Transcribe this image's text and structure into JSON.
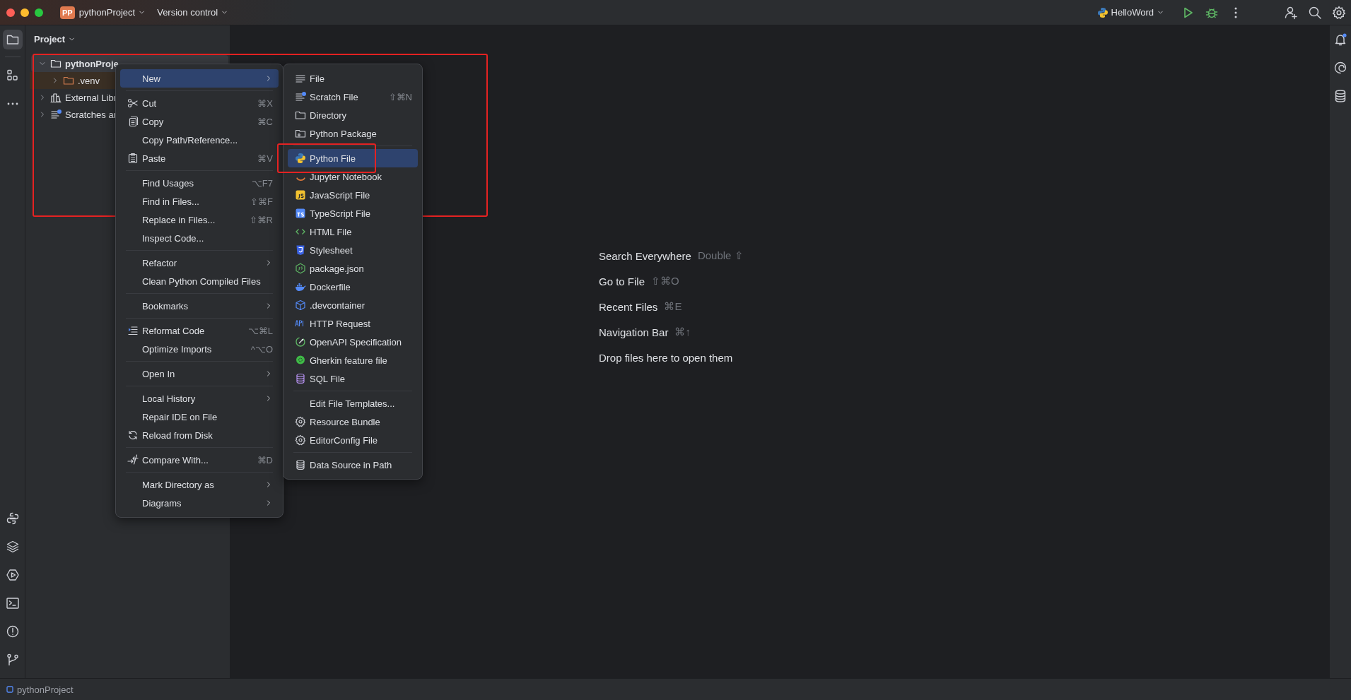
{
  "title_bar": {
    "badge": "PP",
    "project": "pythonProject",
    "vcs": "Version control",
    "run_config": "HelloWord"
  },
  "project_panel": {
    "title": "Project",
    "tree": [
      {
        "label": "pythonProje",
        "kind": "folder",
        "expanded": true,
        "selected": true,
        "children": [
          {
            "label": ".venv",
            "kind": "excluded",
            "expanded": false,
            "selected": false
          }
        ]
      },
      {
        "label": "External Libr",
        "kind": "library",
        "expanded": false,
        "selected": false
      },
      {
        "label": "Scratches ar",
        "kind": "scratches",
        "expanded": false,
        "selected": false
      }
    ]
  },
  "context_menu": {
    "groups": [
      [
        {
          "label": "New",
          "kind": "none",
          "submenu": true,
          "selected": true
        }
      ],
      [
        {
          "label": "Cut",
          "kind": "cut",
          "shortcut": "⌘X",
          "submenu": false,
          "selected": false
        },
        {
          "label": "Copy",
          "kind": "copy",
          "shortcut": "⌘C",
          "submenu": false,
          "selected": false
        },
        {
          "label": "Copy Path/Reference...",
          "kind": "none",
          "submenu": false,
          "selected": false
        },
        {
          "label": "Paste",
          "kind": "paste",
          "shortcut": "⌘V",
          "submenu": false,
          "selected": false
        }
      ],
      [
        {
          "label": "Find Usages",
          "kind": "none",
          "shortcut": "⌥F7",
          "submenu": false,
          "selected": false
        },
        {
          "label": "Find in Files...",
          "kind": "none",
          "shortcut": "⇧⌘F",
          "submenu": false,
          "selected": false
        },
        {
          "label": "Replace in Files...",
          "kind": "none",
          "shortcut": "⇧⌘R",
          "submenu": false,
          "selected": false
        },
        {
          "label": "Inspect Code...",
          "kind": "none",
          "submenu": false,
          "selected": false
        }
      ],
      [
        {
          "label": "Refactor",
          "kind": "none",
          "submenu": true,
          "selected": false
        },
        {
          "label": "Clean Python Compiled Files",
          "kind": "none",
          "submenu": false,
          "selected": false
        }
      ],
      [
        {
          "label": "Bookmarks",
          "kind": "none",
          "submenu": true,
          "selected": false
        }
      ],
      [
        {
          "label": "Reformat Code",
          "kind": "reformat",
          "shortcut": "⌥⌘L",
          "submenu": false,
          "selected": false
        },
        {
          "label": "Optimize Imports",
          "kind": "none",
          "shortcut": "^⌥O",
          "submenu": false,
          "selected": false
        }
      ],
      [
        {
          "label": "Open In",
          "kind": "none",
          "submenu": true,
          "selected": false
        }
      ],
      [
        {
          "label": "Local History",
          "kind": "none",
          "submenu": true,
          "selected": false
        },
        {
          "label": "Repair IDE on File",
          "kind": "none",
          "submenu": false,
          "selected": false
        },
        {
          "label": "Reload from Disk",
          "kind": "reload",
          "submenu": false,
          "selected": false
        }
      ],
      [
        {
          "label": "Compare With...",
          "kind": "compare",
          "shortcut": "⌘D",
          "submenu": false,
          "selected": false
        }
      ],
      [
        {
          "label": "Mark Directory as",
          "kind": "none",
          "submenu": true,
          "selected": false
        },
        {
          "label": "Diagrams",
          "kind": "none",
          "submenu": true,
          "selected": false
        }
      ]
    ]
  },
  "new_submenu": {
    "groups": [
      [
        {
          "label": "File",
          "kind": "text",
          "selected": false
        },
        {
          "label": "Scratch File",
          "kind": "scratch",
          "shortcut": "⇧⌘N",
          "selected": false
        },
        {
          "label": "Directory",
          "kind": "directory",
          "selected": false
        },
        {
          "label": "Python Package",
          "kind": "package",
          "selected": false
        }
      ],
      [
        {
          "label": "Python File",
          "kind": "python",
          "selected": true
        },
        {
          "label": "Jupyter Notebook",
          "kind": "jupyter",
          "selected": false
        },
        {
          "label": "JavaScript File",
          "kind": "javascript",
          "selected": false
        },
        {
          "label": "TypeScript File",
          "kind": "typescript",
          "selected": false
        },
        {
          "label": "HTML File",
          "kind": "html",
          "selected": false
        },
        {
          "label": "Stylesheet",
          "kind": "css",
          "selected": false
        },
        {
          "label": "package.json",
          "kind": "npm",
          "selected": false
        },
        {
          "label": "Dockerfile",
          "kind": "docker",
          "selected": false
        },
        {
          "label": ".devcontainer",
          "kind": "cube",
          "selected": false
        },
        {
          "label": "HTTP Request",
          "kind": "http",
          "selected": false
        },
        {
          "label": "OpenAPI Specification",
          "kind": "openapi",
          "selected": false
        },
        {
          "label": "Gherkin feature file",
          "kind": "gherkin",
          "selected": false
        },
        {
          "label": "SQL File",
          "kind": "sql",
          "selected": false
        }
      ],
      [
        {
          "label": "Edit File Templates...",
          "kind": "none",
          "selected": false
        },
        {
          "label": "Resource Bundle",
          "kind": "gear",
          "selected": false
        },
        {
          "label": "EditorConfig File",
          "kind": "gear",
          "selected": false
        }
      ],
      [
        {
          "label": "Data Source in Path",
          "kind": "datasource",
          "selected": false
        }
      ]
    ]
  },
  "welcome": [
    {
      "label": "Search Everywhere",
      "shortcut": "Double ⇧"
    },
    {
      "label": "Go to File",
      "shortcut": "⇧⌘O"
    },
    {
      "label": "Recent Files",
      "shortcut": "⌘E"
    },
    {
      "label": "Navigation Bar",
      "shortcut": "⌘↑"
    },
    {
      "label": "Drop files here to open them"
    }
  ],
  "annotations": [
    {
      "kind": "frame"
    },
    {
      "kind": "frame"
    }
  ],
  "status_bar": {
    "project": "pythonProject"
  }
}
